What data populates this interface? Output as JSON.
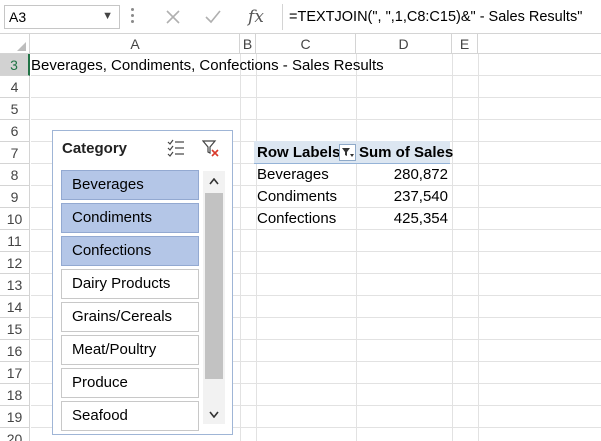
{
  "formula_bar": {
    "name_box": "A3",
    "cancel_icon": "x-icon",
    "enter_icon": "checkmark-icon",
    "fx_label": "fx",
    "formula": "=TEXTJOIN(\", \",1,C8:C15)&\" - Sales Results\""
  },
  "columns": [
    "A",
    "B",
    "C",
    "D",
    "E"
  ],
  "rows": [
    "3",
    "4",
    "5",
    "6",
    "7",
    "8",
    "9",
    "10",
    "11",
    "12",
    "13",
    "14",
    "15",
    "16",
    "17",
    "18",
    "19",
    "20"
  ],
  "active_row": "3",
  "cell_a3": "Beverages, Condiments, Confections - Sales Results",
  "slicer": {
    "title": "Category",
    "multiselect_icon": "multiselect-icon",
    "clear_filter_icon": "clear-filter-icon",
    "items": [
      {
        "label": "Beverages",
        "selected": true
      },
      {
        "label": "Condiments",
        "selected": true
      },
      {
        "label": "Confections",
        "selected": true
      },
      {
        "label": "Dairy Products",
        "selected": false
      },
      {
        "label": "Grains/Cereals",
        "selected": false
      },
      {
        "label": "Meat/Poultry",
        "selected": false
      },
      {
        "label": "Produce",
        "selected": false
      },
      {
        "label": "Seafood",
        "selected": false
      }
    ]
  },
  "pivot": {
    "row_labels_header": "Row Labels",
    "filter_icon": "filter-dropdown-icon",
    "sum_header": "Sum of Sales",
    "rows": [
      {
        "label": "Beverages",
        "value": "280,872"
      },
      {
        "label": "Condiments",
        "value": "237,540"
      },
      {
        "label": "Confections",
        "value": "425,354"
      }
    ]
  }
}
